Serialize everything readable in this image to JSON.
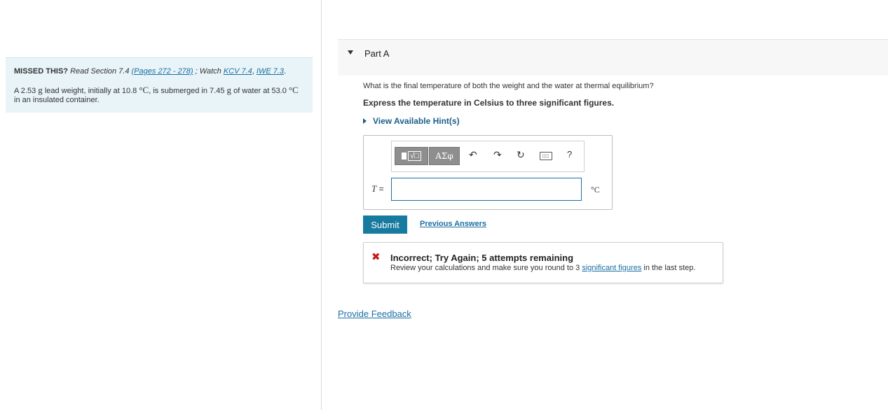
{
  "left": {
    "missed_label": "MISSED THIS?",
    "read_text": "Read Section 7.4",
    "pages_link": "(Pages 272 - 278)",
    "watch_text": "; Watch",
    "kcv_link": "KCV 7.4",
    "comma": ",",
    "iwe_link": "IWE 7.3",
    "period": ".",
    "problem_p1": "A 2.53",
    "unit_g1": "g",
    "problem_p2": "lead weight, initially at 10.8",
    "unit_c1": "°C",
    "problem_p3": ", is submerged in 7.45",
    "unit_g2": "g",
    "problem_p4": "of water at 53.0",
    "unit_c2": "°C",
    "problem_p5": "in an insulated container."
  },
  "part": {
    "title": "Part A",
    "question": "What is the final temperature of both the weight and the water at thermal equilibrium?",
    "instruction": "Express the temperature in Celsius to three significant figures.",
    "hints_label": "View Available Hint(s)"
  },
  "answer": {
    "variable": "T",
    "equals": "=",
    "value": "",
    "unit": "°C",
    "toolbar": {
      "templates_label": "√□",
      "symbols_label": "ΑΣφ",
      "undo_icon": "↶",
      "redo_icon": "↷",
      "reset_icon": "↻",
      "help_label": "?"
    }
  },
  "actions": {
    "submit_label": "Submit",
    "previous_answers_label": "Previous Answers"
  },
  "feedback": {
    "status_icon": "✖",
    "title": "Incorrect; Try Again; 5 attempts remaining",
    "msg_before": "Review your calculations and make sure you round to 3 ",
    "msg_link": "significant figures",
    "msg_after": " in the last step."
  },
  "footer": {
    "provide_feedback": "Provide Feedback"
  },
  "colors": {
    "left_panel_bg": "#e8f4f8",
    "submit_bg": "#177a9f",
    "link": "#1a6fa3",
    "error": "#c41c1c"
  }
}
